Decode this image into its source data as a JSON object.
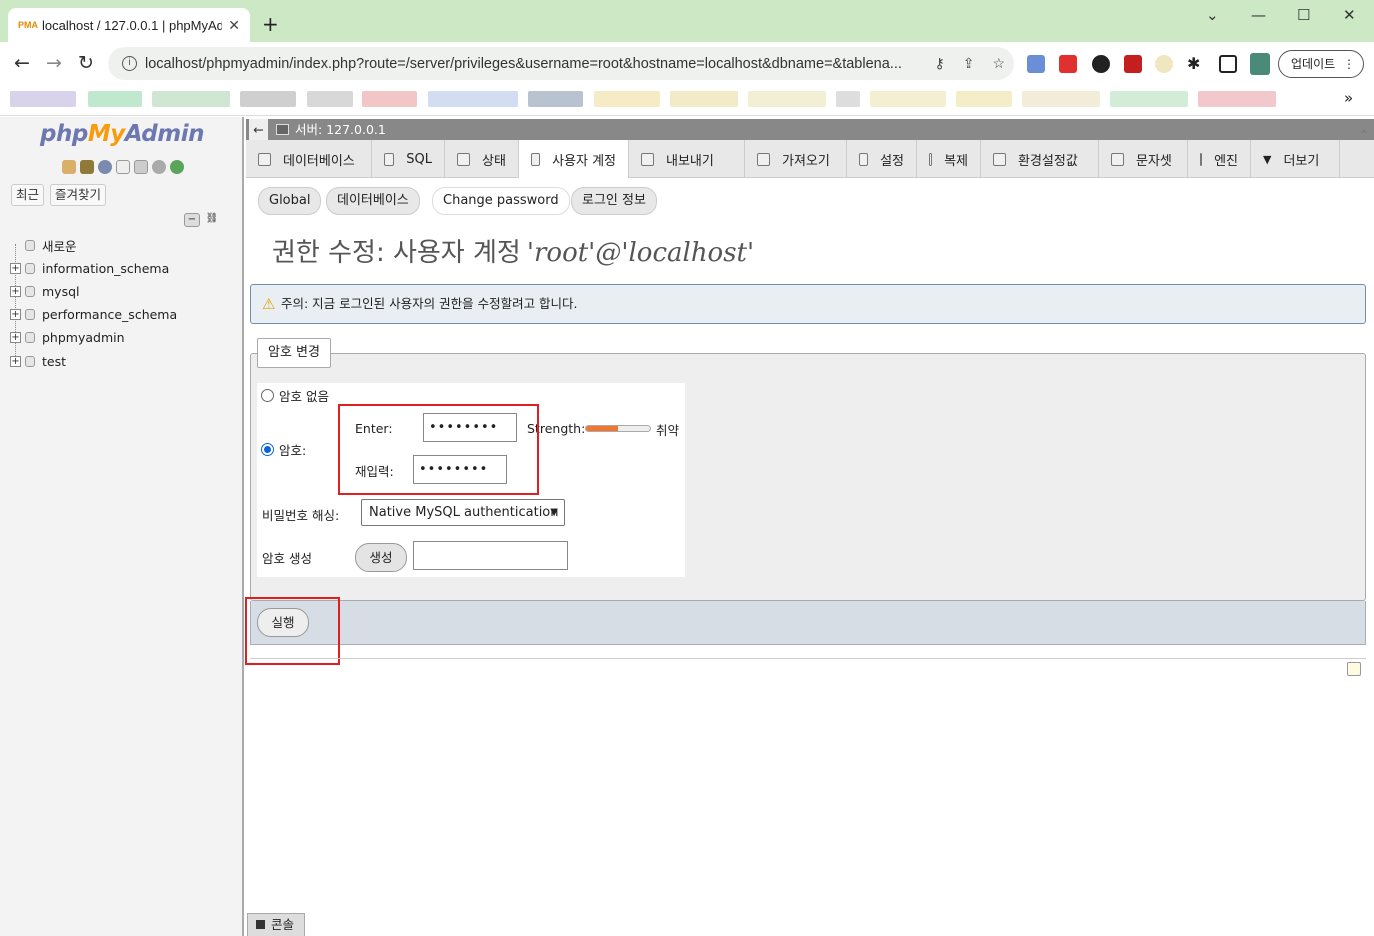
{
  "browser": {
    "tab_title": "localhost / 127.0.0.1 | phpMyAd",
    "favicon_text": "PMA",
    "new_tab": "+",
    "url": "localhost/phpmyadmin/index.php?route=/server/privileges&username=root&hostname=localhost&dbname=&tablena...",
    "update_button": "업데이트",
    "menu_dots": "⋮",
    "bookmarks_more": "»"
  },
  "sidebar": {
    "logo_php": "php",
    "logo_my": "My",
    "logo_admin": "Admin",
    "recent": "최근",
    "favorites": "즐겨찾기",
    "collapse": "−",
    "link": "⛓",
    "tree": [
      {
        "label": "새로운",
        "expandable": false
      },
      {
        "label": "information_schema",
        "expandable": true
      },
      {
        "label": "mysql",
        "expandable": true
      },
      {
        "label": "performance_schema",
        "expandable": true
      },
      {
        "label": "phpmyadmin",
        "expandable": true
      },
      {
        "label": "test",
        "expandable": true
      }
    ]
  },
  "server_bar": {
    "back": "←",
    "label": "서버: 127.0.0.1"
  },
  "tabs": [
    {
      "label": "데이터베이스",
      "active": false
    },
    {
      "label": "SQL",
      "active": false
    },
    {
      "label": "상태",
      "active": false
    },
    {
      "label": "사용자 계정",
      "active": true
    },
    {
      "label": "내보내기",
      "active": false
    },
    {
      "label": "가져오기",
      "active": false
    },
    {
      "label": "설정",
      "active": false
    },
    {
      "label": "복제",
      "active": false
    },
    {
      "label": "환경설정값",
      "active": false
    },
    {
      "label": "문자셋",
      "active": false
    },
    {
      "label": "엔진",
      "active": false
    },
    {
      "label": "더보기",
      "active": false
    }
  ],
  "subtabs": [
    {
      "label": "Global",
      "active": false
    },
    {
      "label": "데이터베이스",
      "active": false
    },
    {
      "label": "Change password",
      "active": true
    },
    {
      "label": "로그인 정보",
      "active": false
    }
  ],
  "page": {
    "title": "권한 수정: 사용자 계정",
    "title_user": "'root'@'localhost'",
    "notice": "주의: 지금 로그인된 사용자의 권한을 수정할려고 합니다."
  },
  "form": {
    "legend": "암호 변경",
    "no_password": "암호 없음",
    "password": "암호:",
    "enter": "Enter:",
    "reenter": "재입력:",
    "password_mask": "••••••••",
    "reenter_mask": "••••••••",
    "strength_label": "Strength:",
    "strength_value": "취약",
    "strength_level": 0.5,
    "hashing_label": "비밀번호 해싱:",
    "hashing_value": "Native MySQL authentication",
    "generate_label": "암호 생성",
    "generate_button": "생성",
    "submit": "실행"
  },
  "console": {
    "label": "콘솔"
  },
  "colors": {
    "titlebar": "#cde8c5",
    "highlight": "#e02020",
    "logo_blue": "#6c78af",
    "logo_orange": "#f89c0e"
  }
}
